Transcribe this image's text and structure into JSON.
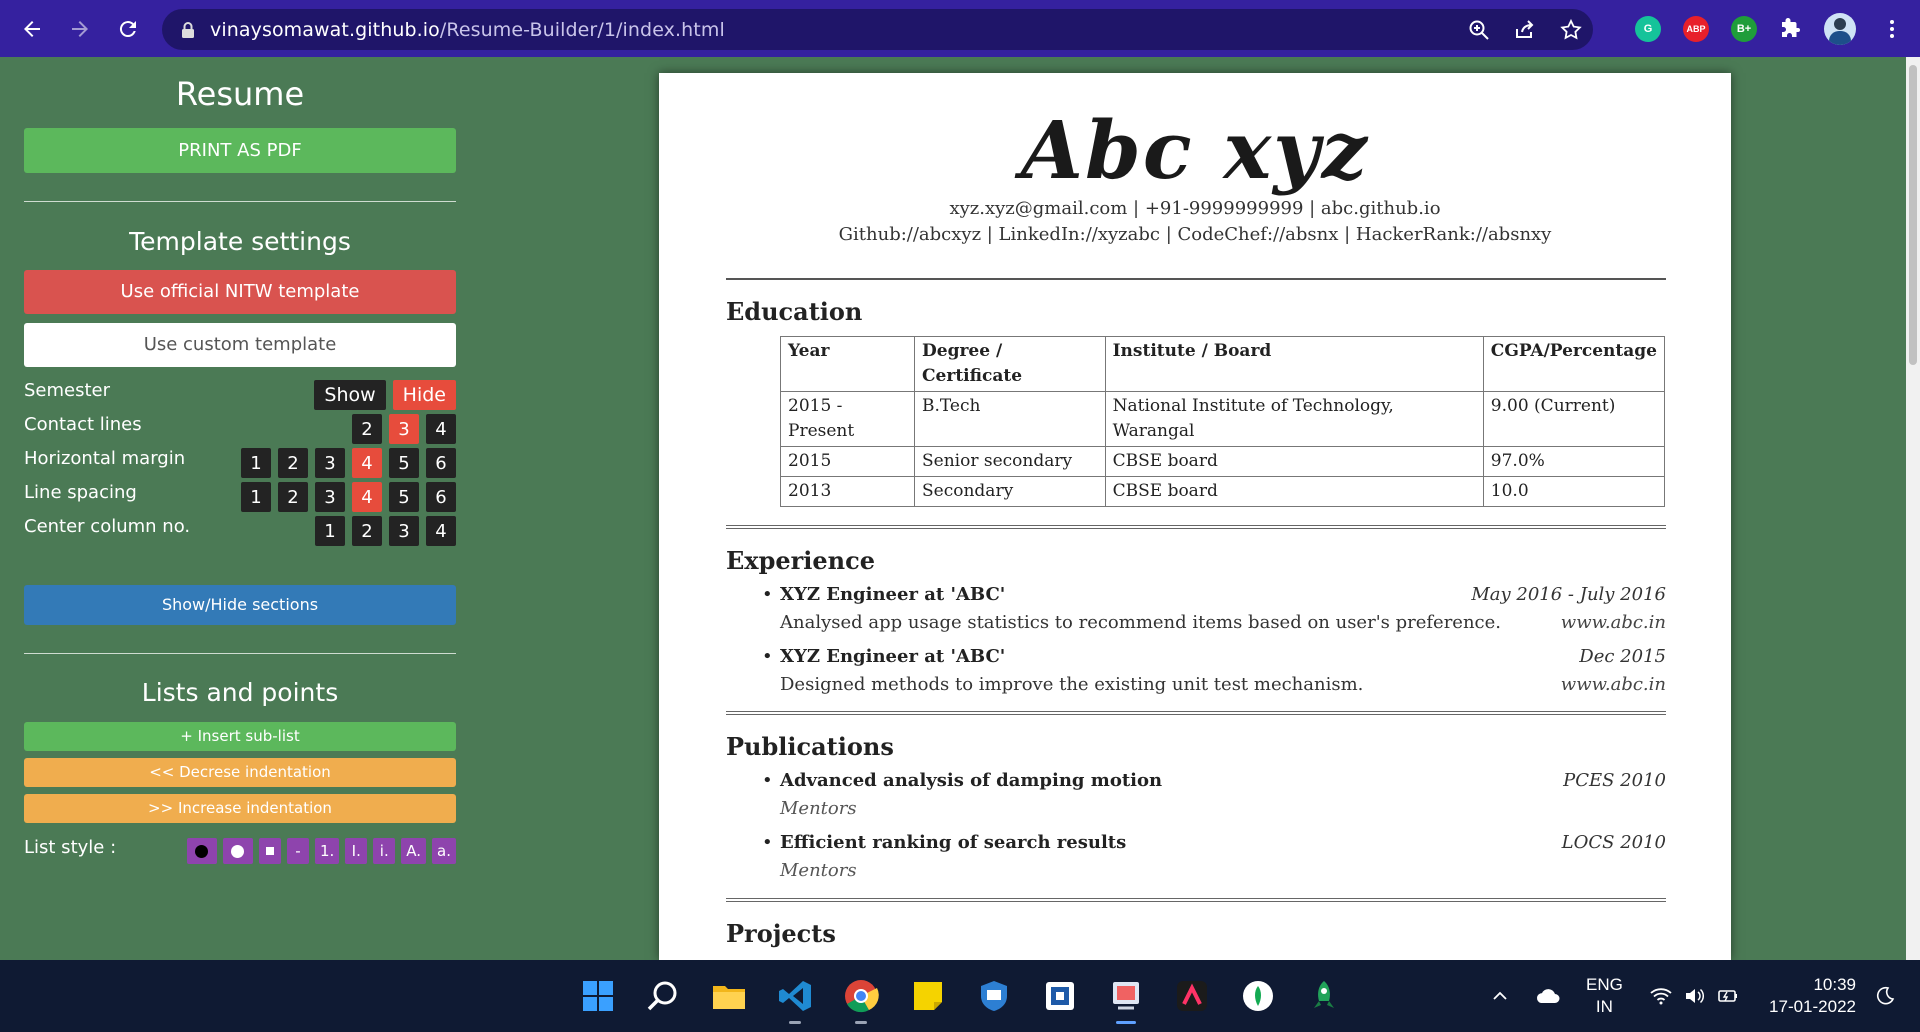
{
  "browser": {
    "url_host": "vinaysomawat.github.io",
    "url_path": "/Resume-Builder/1/index.html",
    "extensions": [
      {
        "name": "grammarly",
        "label": "G",
        "color": "#15c39a"
      },
      {
        "name": "adblock",
        "label": "ABP",
        "color": "#e8202a"
      },
      {
        "name": "bplus",
        "label": "B+",
        "color": "#1f9d3a"
      }
    ]
  },
  "sidebar": {
    "title": "Resume",
    "print_label": "PRINT AS PDF",
    "template_title": "Template settings",
    "nitw_label": "Use official NITW template",
    "custom_label": "Use custom template",
    "settings": {
      "semester": {
        "label": "Semester",
        "options": [
          "Show",
          "Hide"
        ],
        "active": "Hide"
      },
      "contact": {
        "label": "Contact lines",
        "options": [
          "2",
          "3",
          "4"
        ],
        "active": "3"
      },
      "hmargin": {
        "label": "Horizontal margin",
        "options": [
          "1",
          "2",
          "3",
          "4",
          "5",
          "6"
        ],
        "active": "4"
      },
      "spacing": {
        "label": "Line spacing",
        "options": [
          "1",
          "2",
          "3",
          "4",
          "5",
          "6"
        ],
        "active": "4"
      },
      "center": {
        "label": "Center column no.",
        "options": [
          "1",
          "2",
          "3",
          "4"
        ],
        "active": ""
      }
    },
    "sections_label": "Show/Hide sections",
    "lists_title": "Lists and points",
    "insert_label": "+ Insert sub-list",
    "decrease_label": "<< Decrese indentation",
    "increase_label": ">> Increase indentation",
    "list_style_label": "List style :",
    "list_styles": [
      "●",
      "⬤",
      "■",
      "-",
      "1.",
      "I.",
      "i.",
      "A.",
      "a."
    ]
  },
  "resume": {
    "name": "Abc xyz",
    "contact_line1": "xyz.xyz@gmail.com | +91-9999999999 | abc.github.io",
    "contact_line2": "Github://abcxyz | LinkedIn://xyzabc | CodeChef://absnx | HackerRank://absnxy",
    "education": {
      "heading": "Education",
      "columns": [
        "Year",
        "Degree / Certificate",
        "Institute / Board",
        "CGPA/Percentage"
      ],
      "rows": [
        [
          "2015 - Present",
          "B.Tech",
          "National Institute of Technology, Warangal",
          "9.00 (Current)"
        ],
        [
          "2015",
          "Senior secondary",
          "CBSE board",
          "97.0%"
        ],
        [
          "2013",
          "Secondary",
          "CBSE board",
          "10.0"
        ]
      ]
    },
    "experience": {
      "heading": "Experience",
      "items": [
        {
          "title": "XYZ Engineer at 'ABC'",
          "desc": "Analysed app usage statistics to recommend items based on user's preference.",
          "date": "May 2016 - July 2016",
          "site": "www.abc.in"
        },
        {
          "title": "XYZ Engineer at 'ABC'",
          "desc": "Designed methods to improve the existing unit test mechanism.",
          "date": "Dec 2015",
          "site": "www.abc.in"
        }
      ]
    },
    "publications": {
      "heading": "Publications",
      "items": [
        {
          "title": "Advanced analysis of damping motion",
          "desc": "Mentors",
          "venue": "PCES 2010"
        },
        {
          "title": "Efficient ranking of search results",
          "desc": "Mentors",
          "venue": "LOCS 2010"
        }
      ]
    },
    "projects": {
      "heading": "Projects"
    }
  },
  "taskbar": {
    "lang1": "ENG",
    "lang2": "IN",
    "time": "10:39",
    "date": "17-01-2022"
  }
}
